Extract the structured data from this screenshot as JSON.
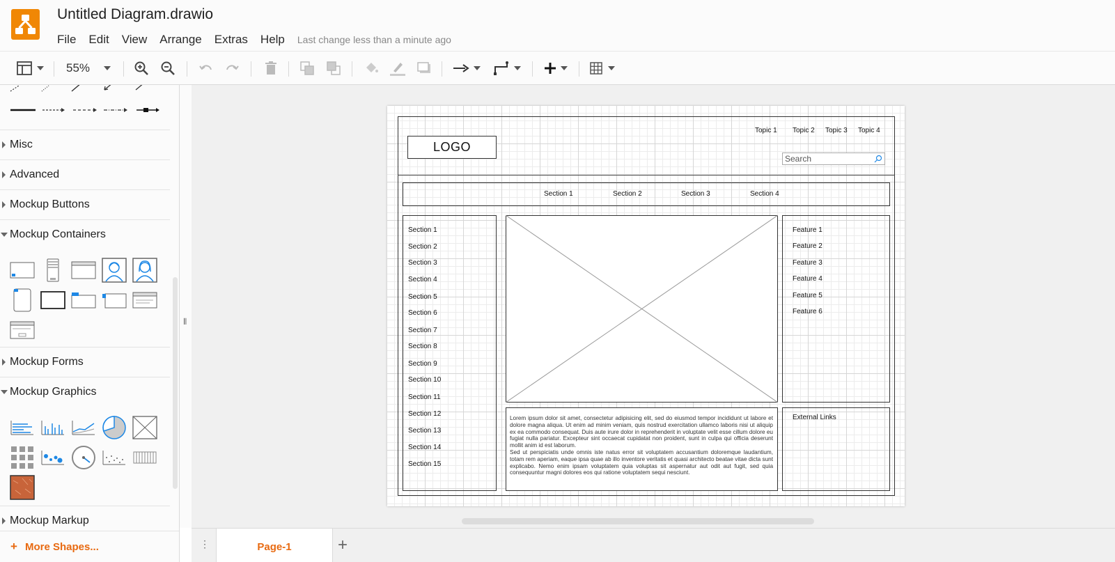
{
  "app": {
    "title": "Untitled Diagram.drawio",
    "menu": [
      "File",
      "Edit",
      "View",
      "Arrange",
      "Extras",
      "Help"
    ],
    "last_change": "Last change less than a minute ago"
  },
  "toolbar": {
    "zoom": "55%",
    "icons": [
      "format-panel-icon",
      "zoom-in-icon",
      "zoom-out-icon",
      "undo-icon",
      "redo-icon",
      "delete-icon",
      "to-front-icon",
      "to-back-icon",
      "fill-color-icon",
      "line-color-icon",
      "shadow-icon",
      "connection-icon",
      "waypoints-icon",
      "insert-icon",
      "table-icon"
    ]
  },
  "sidebar": {
    "sections": [
      {
        "label": "Misc",
        "expanded": false
      },
      {
        "label": "Advanced",
        "expanded": false
      },
      {
        "label": "Mockup Buttons",
        "expanded": false
      },
      {
        "label": "Mockup Containers",
        "expanded": true
      },
      {
        "label": "Mockup Forms",
        "expanded": false
      },
      {
        "label": "Mockup Graphics",
        "expanded": true
      },
      {
        "label": "Mockup Markup",
        "expanded": false
      }
    ],
    "more_shapes": "More Shapes..."
  },
  "diagram": {
    "logo": "LOGO",
    "topics": [
      "Topic 1",
      "Topic 2",
      "Topic 3",
      "Topic 4"
    ],
    "search_placeholder": "Search",
    "nav_sections": [
      "Section 1",
      "Section 2",
      "Section 3",
      "Section 4"
    ],
    "left_sections": [
      "Section 1",
      "Section 2",
      "Section 3",
      "Section 4",
      "Section 5",
      "Section 6",
      "Section 7",
      "Section 8",
      "Section 9",
      "Section 10",
      "Section 11",
      "Section 12",
      "Section 13",
      "Section 14",
      "Section 15"
    ],
    "features": [
      "Feature 1",
      "Feature 2",
      "Feature 3",
      "Feature 4",
      "Feature 5",
      "Feature 6"
    ],
    "external_links": "External Links",
    "lorem": "Lorem ipsum dolor sit amet, consectetur adipisicing elit, sed do eiusmod tempor incididunt ut labore et dolore magna aliqua. Ut enim ad minim veniam, quis nostrud exercitation ullamco laboris nisi ut aliquip ex ea commodo consequat. Duis aute irure dolor in reprehenderit in voluptate velit esse cillum dolore eu fugiat nulla pariatur. Excepteur sint occaecat cupidatat non proident, sunt in culpa qui officia deserunt mollit anim id est laborum.",
    "lorem2": "Sed ut perspiciatis unde omnis iste natus error sit voluptatem accusantium doloremque laudantium, totam rem aperiam, eaque ipsa quae ab illo inventore veritatis et quasi architecto beatae vitae dicta sunt explicabo. Nemo enim ipsam voluptatem quia voluptas sit aspernatur aut odit aut fugit, sed quia consequuntur magni dolores eos qui ratione voluptatem sequi nesciunt."
  },
  "pages": {
    "tabs": [
      "Page-1"
    ]
  },
  "colors": {
    "accent": "#e86a11",
    "logo": "#f08705",
    "shape_blue": "#1e88e5"
  }
}
